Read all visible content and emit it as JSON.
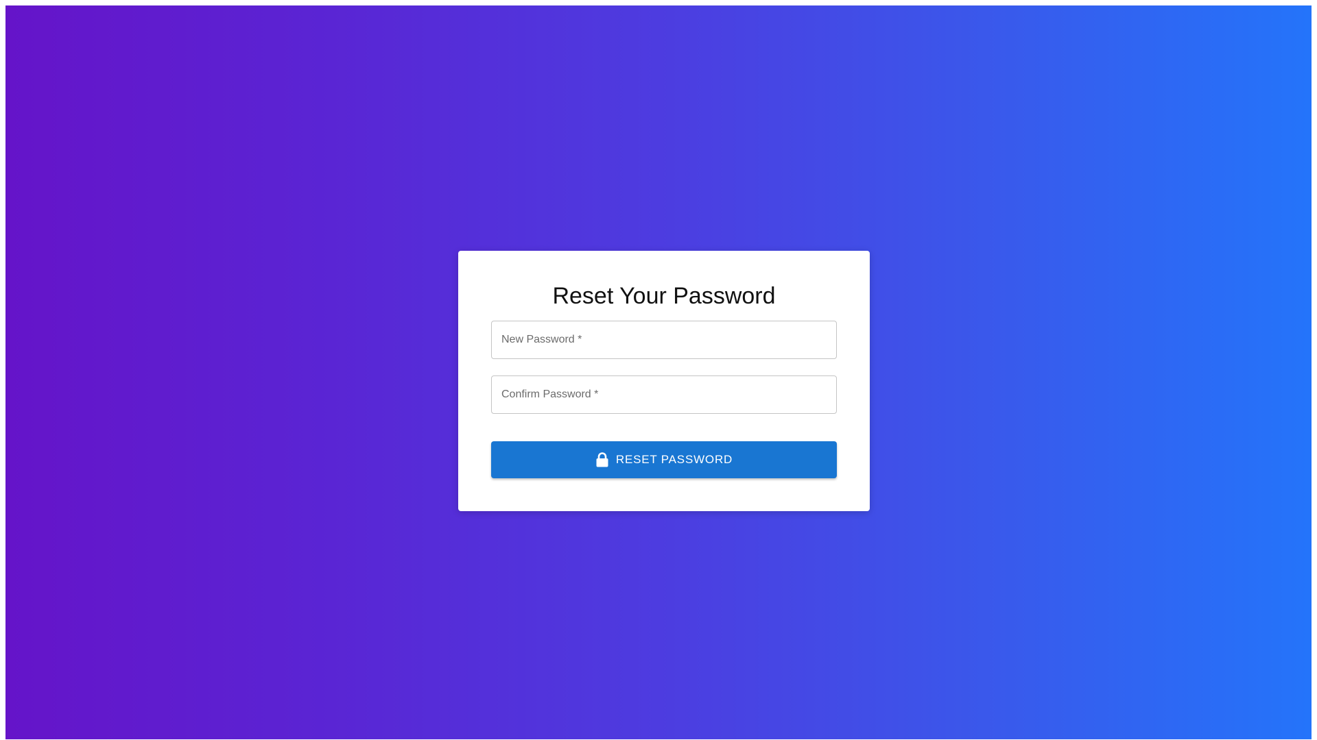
{
  "colors": {
    "background_gradient_start": "#6514c9",
    "background_gradient_end": "#2474fa",
    "card_background": "#ffffff",
    "button_background": "#1976d2",
    "button_text": "#ffffff"
  },
  "card": {
    "title": "Reset Your Password",
    "new_password_label": "New Password *",
    "confirm_password_label": "Confirm Password *",
    "submit_label": "RESET PASSWORD",
    "submit_icon": "lock-icon"
  }
}
